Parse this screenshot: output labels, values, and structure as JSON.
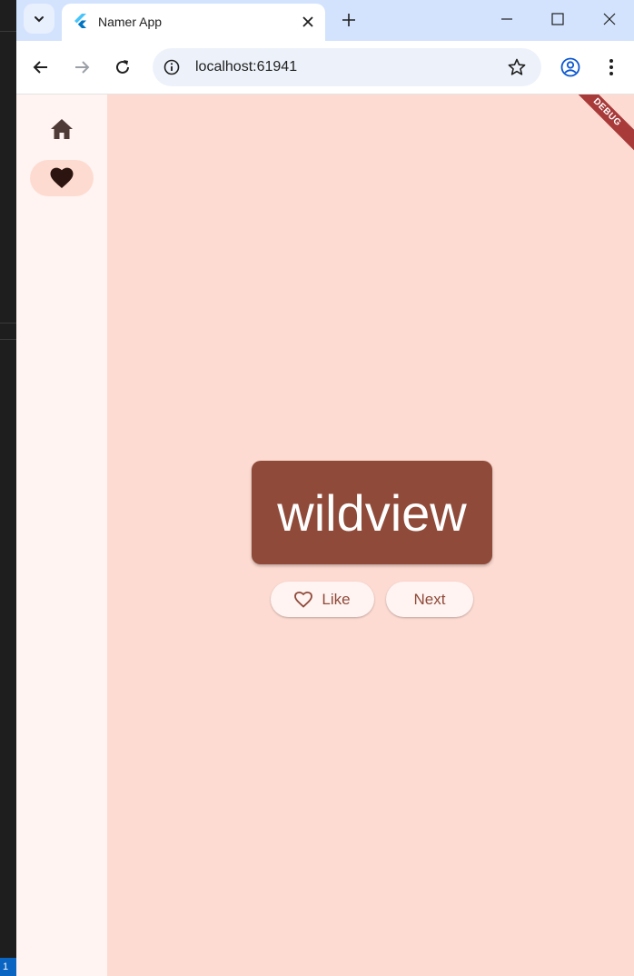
{
  "browser": {
    "tab_title": "Namer App",
    "url": "localhost:61941"
  },
  "app": {
    "word": "wildview",
    "like_label": "Like",
    "next_label": "Next",
    "debug_banner": "DEBUG",
    "rail": [
      {
        "icon": "home-icon",
        "selected": false
      },
      {
        "icon": "heart-icon",
        "selected": true
      }
    ]
  },
  "desktop": {
    "badge": "1"
  },
  "colors": {
    "background": "#fddbd2",
    "card": "#8f4a39",
    "rail": "#fff4f2",
    "rail_selected": "#fedbd0",
    "tab_bar": "#d3e3fd"
  }
}
